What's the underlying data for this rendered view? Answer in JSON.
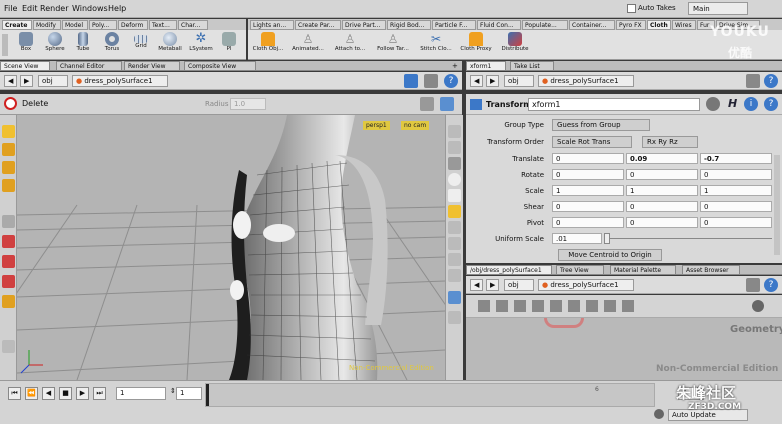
{
  "menubar": {
    "items": [
      "File",
      "Edit",
      "Render",
      "Windows",
      "Help"
    ],
    "auto_takes": "Auto Takes",
    "desktop": "Main"
  },
  "shelf_tabs_left": [
    "Create",
    "Modify",
    "Model",
    "Poly...",
    "Deform",
    "Text...",
    "Char..."
  ],
  "shelf_tabs_right": [
    "Lights an...",
    "Create Par...",
    "Drive Part...",
    "Rigid Bod...",
    "Particle F...",
    "Fluid Con...",
    "Populate...",
    "Container...",
    "Pyro FX",
    "Cloth",
    "Wires",
    "Fur",
    "Drive Sim..."
  ],
  "tools_left": [
    "Box",
    "Sphere",
    "Tube",
    "Torus",
    "Grid",
    "Metaball",
    "LSystem",
    "Pl"
  ],
  "tools_right": [
    "Cloth Obj...",
    "Animated...",
    "Attach to...",
    "Follow Tar...",
    "Stitch Clo...",
    "Cloth Proxy",
    "Distribute"
  ],
  "left_pane": {
    "tabs": [
      "Scene View",
      "Channel Editor",
      "Render View",
      "Composite View"
    ],
    "path": {
      "root": "obj",
      "node": "dress_polySurface1"
    },
    "delete_label": "Delete",
    "radius_label": "Radius",
    "radius_value": "1.0",
    "camera_menu": "persp1",
    "cam_menu": "no cam",
    "watermark": "Non-Commercial Edition"
  },
  "param_pane": {
    "tabs": [
      "xform1",
      "Take List"
    ],
    "path": {
      "root": "obj",
      "node": "dress_polySurface1"
    },
    "node_type": "Transform",
    "node_name": "xform1",
    "rows": {
      "group_type": {
        "label": "Group Type",
        "value": "Guess from Group"
      },
      "transform_order": {
        "label": "Transform Order",
        "value": "Scale Rot Trans",
        "rot_value": "Rx Ry Rz"
      },
      "translate": {
        "label": "Translate",
        "x": "0",
        "y": "0.09",
        "z": "-0.7"
      },
      "rotate": {
        "label": "Rotate",
        "x": "0",
        "y": "0",
        "z": "0"
      },
      "scale": {
        "label": "Scale",
        "x": "1",
        "y": "1",
        "z": "1"
      },
      "shear": {
        "label": "Shear",
        "x": "0",
        "y": "0",
        "z": "0"
      },
      "pivot": {
        "label": "Pivot",
        "x": "0",
        "y": "0",
        "z": "0"
      },
      "uniform_scale": {
        "label": "Uniform Scale",
        "value": ".01"
      }
    },
    "move_centroid": "Move Centroid to Origin"
  },
  "network_pane": {
    "tabs": [
      "/obj/dress_polySurface1",
      "Tree View",
      "Material Palette",
      "Asset Browser"
    ],
    "path": {
      "root": "obj",
      "node": "dress_polySurface1"
    },
    "context_label": "Geometry",
    "watermark": "Non-Commercial Edition"
  },
  "timeline": {
    "frame": "1",
    "start": "1",
    "end_left": "6",
    "end_right": "6",
    "auto_update": "Auto Update"
  },
  "overlay_watermarks": {
    "youku": "YOUKU",
    "youku_sub": "优酷",
    "site_cn": "朱峰社区",
    "site_en": "ZF3D.COM"
  },
  "colors": {
    "accent_orange": "#f5a623",
    "viewport_bg": "#b4b4b4",
    "watermark_yellow": "#e0c840"
  }
}
